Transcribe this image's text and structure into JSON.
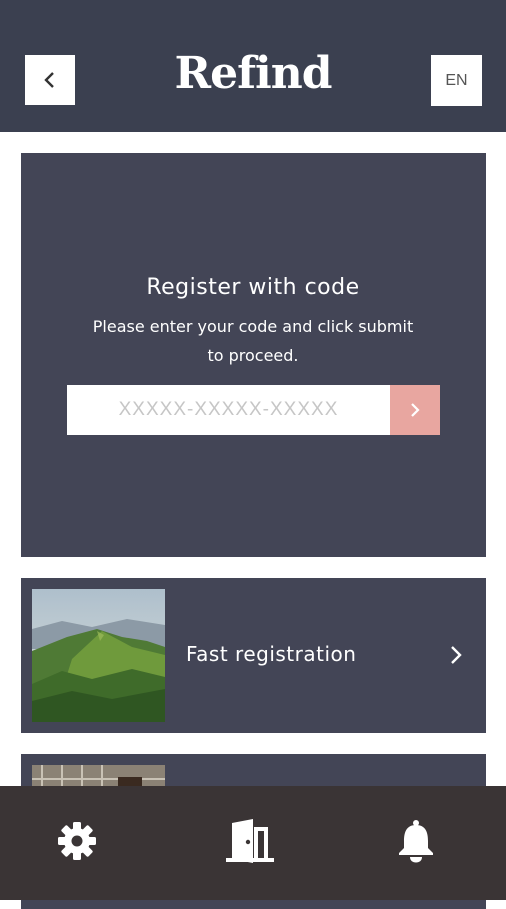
{
  "header": {
    "back_icon": "chevron-left-icon",
    "logo_text": "Refind",
    "language_label": "EN"
  },
  "register": {
    "title": "Register with code",
    "description": "Please enter your code and click submit to proceed.",
    "code_value": "",
    "code_placeholder": "XXXXX-XXXXX-XXXXX",
    "submit_icon": "chevron-right-icon",
    "submit_color": "#e8a6a0"
  },
  "cards": [
    {
      "label": "Fast registration",
      "image": "mountain-landscape",
      "icon": "chevron-right-icon"
    },
    {
      "label": "",
      "image": "person-photo"
    }
  ],
  "bottom_nav": {
    "items": [
      {
        "icon": "gear-icon"
      },
      {
        "icon": "door-icon"
      },
      {
        "icon": "bell-icon"
      }
    ]
  },
  "colors": {
    "header_bg": "#3b4050",
    "card_bg": "#434556",
    "nav_bg": "#3a3435",
    "accent": "#e8a6a0"
  }
}
